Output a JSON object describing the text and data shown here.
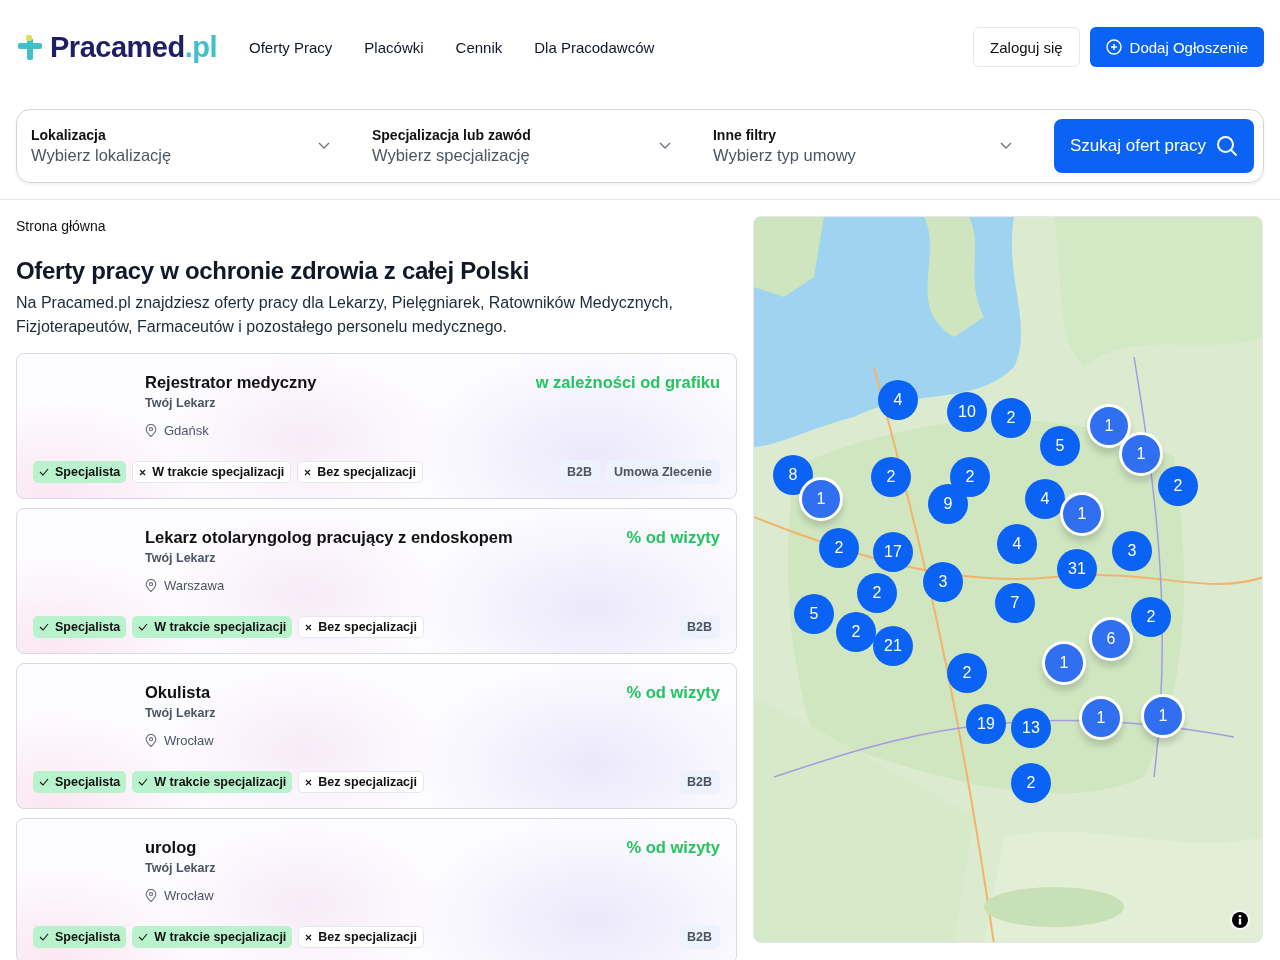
{
  "header": {
    "logo": {
      "name": "Pracamed",
      "suffix": ".pl"
    },
    "nav": [
      "Oferty Pracy",
      "Placówki",
      "Cennik",
      "Dla Pracodawców"
    ],
    "login": "Zaloguj się",
    "add": "Dodaj Ogłoszenie"
  },
  "filters": {
    "fields": [
      {
        "label": "Lokalizacja",
        "placeholder": "Wybierz lokalizację"
      },
      {
        "label": "Specjalizacja lub zawód",
        "placeholder": "Wybierz specjalizację"
      },
      {
        "label": "Inne filtry",
        "placeholder": "Wybierz typ umowy"
      }
    ],
    "search": "Szukaj ofert pracy"
  },
  "breadcrumb": "Strona główna",
  "title": "Oferty pracy w ochronie zdrowia z całej Polski",
  "intro": "Na Pracamed.pl znajdziesz oferty pracy dla Lekarzy, Pielęgniarek, Ratowników Medycznych, Fizjoterapeutów, Farmaceutów i pozostałego personelu medycznego.",
  "jobs": [
    {
      "title": "Rejestrator medyczny",
      "company": "Twój Lekarz",
      "location": "Gdańsk",
      "pay": "w zależności od grafiku",
      "tags": [
        {
          "label": "Specjalista",
          "checked": true
        },
        {
          "label": "W trakcie specjalizacji",
          "checked": false
        },
        {
          "label": "Bez specjalizacji",
          "checked": false
        }
      ],
      "contracts": [
        "B2B",
        "Umowa Zlecenie"
      ]
    },
    {
      "title": "Lekarz otolaryngolog pracujący z endoskopem",
      "company": "Twój Lekarz",
      "location": "Warszawa",
      "pay": "% od wizyty",
      "tags": [
        {
          "label": "Specjalista",
          "checked": true
        },
        {
          "label": "W trakcie specjalizacji",
          "checked": true
        },
        {
          "label": "Bez specjalizacji",
          "checked": false
        }
      ],
      "contracts": [
        "B2B"
      ]
    },
    {
      "title": "Okulista",
      "company": "Twój Lekarz",
      "location": "Wrocław",
      "pay": "% od wizyty",
      "tags": [
        {
          "label": "Specjalista",
          "checked": true
        },
        {
          "label": "W trakcie specjalizacji",
          "checked": true
        },
        {
          "label": "Bez specjalizacji",
          "checked": false
        }
      ],
      "contracts": [
        "B2B"
      ]
    },
    {
      "title": "urolog",
      "company": "Twój Lekarz",
      "location": "Wrocław",
      "pay": "% od wizyty",
      "tags": [
        {
          "label": "Specjalista",
          "checked": true
        },
        {
          "label": "W trakcie specjalizacji",
          "checked": true
        },
        {
          "label": "Bez specjalizacji",
          "checked": false
        }
      ],
      "contracts": [
        "B2B"
      ]
    }
  ],
  "map": {
    "markers": [
      {
        "count": "4",
        "kind": "cluster"
      },
      {
        "count": "10",
        "kind": "cluster"
      },
      {
        "count": "2",
        "kind": "cluster"
      },
      {
        "count": "5",
        "kind": "cluster"
      },
      {
        "count": "1",
        "kind": "pin"
      },
      {
        "count": "1",
        "kind": "pin"
      },
      {
        "count": "8",
        "kind": "cluster"
      },
      {
        "count": "1",
        "kind": "pin"
      },
      {
        "count": "2",
        "kind": "cluster"
      },
      {
        "count": "2",
        "kind": "cluster"
      },
      {
        "count": "9",
        "kind": "cluster"
      },
      {
        "count": "4",
        "kind": "cluster"
      },
      {
        "count": "1",
        "kind": "pin"
      },
      {
        "count": "2",
        "kind": "cluster"
      },
      {
        "count": "2",
        "kind": "cluster"
      },
      {
        "count": "17",
        "kind": "cluster"
      },
      {
        "count": "4",
        "kind": "cluster"
      },
      {
        "count": "3",
        "kind": "cluster"
      },
      {
        "count": "31",
        "kind": "cluster"
      },
      {
        "count": "3",
        "kind": "cluster"
      },
      {
        "count": "2",
        "kind": "cluster"
      },
      {
        "count": "7",
        "kind": "cluster"
      },
      {
        "count": "5",
        "kind": "cluster"
      },
      {
        "count": "2",
        "kind": "cluster"
      },
      {
        "count": "21",
        "kind": "cluster"
      },
      {
        "count": "2",
        "kind": "cluster"
      },
      {
        "count": "6",
        "kind": "pin"
      },
      {
        "count": "1",
        "kind": "pin"
      },
      {
        "count": "2",
        "kind": "cluster"
      },
      {
        "count": "19",
        "kind": "cluster"
      },
      {
        "count": "13",
        "kind": "cluster"
      },
      {
        "count": "1",
        "kind": "pin"
      },
      {
        "count": "1",
        "kind": "pin"
      },
      {
        "count": "2",
        "kind": "cluster"
      }
    ]
  }
}
